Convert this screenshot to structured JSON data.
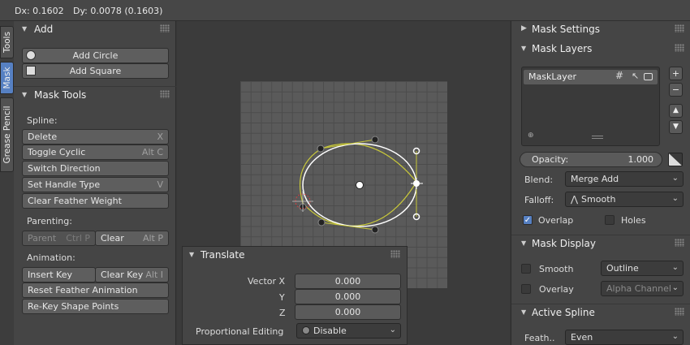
{
  "header": {
    "dx_label": "Dx: 0.1602",
    "dy_label": "Dy: 0.0078 (0.1603)"
  },
  "tabs": [
    {
      "label": "Tools"
    },
    {
      "label": "Mask"
    },
    {
      "label": "Grease Pencil"
    }
  ],
  "add_panel": {
    "title": "Add",
    "add_circle": "Add Circle",
    "add_square": "Add Square"
  },
  "mask_tools": {
    "title": "Mask Tools",
    "spline_label": "Spline:",
    "delete": "Delete",
    "delete_sc": "X",
    "toggle_cyclic": "Toggle Cyclic",
    "toggle_cyclic_sc": "Alt C",
    "switch_direction": "Switch Direction",
    "set_handle_type": "Set Handle Type",
    "set_handle_type_sc": "V",
    "clear_feather": "Clear Feather Weight",
    "parenting_label": "Parenting:",
    "parent": "Parent",
    "parent_sc": "Ctrl P",
    "clear": "Clear",
    "clear_sc": "Alt P",
    "animation_label": "Animation:",
    "insert_key": "Insert Key",
    "clear_key": "Clear Key",
    "clear_key_sc": "Alt I",
    "reset_feather": "Reset Feather Animation",
    "rekey": "Re-Key Shape Points"
  },
  "translate": {
    "title": "Translate",
    "vector_x_label": "Vector X",
    "vector_x": "0.000",
    "y_label": "Y",
    "y": "0.000",
    "z_label": "Z",
    "z": "0.000",
    "prop_label": "Proportional Editing",
    "prop_value": "Disable"
  },
  "right": {
    "mask_settings": "Mask Settings",
    "mask_layers": "Mask Layers",
    "layer_name": "MaskLayer",
    "opacity_label": "Opacity:",
    "opacity": "1.000",
    "blend_label": "Blend:",
    "blend": "Merge Add",
    "falloff_label": "Falloff:",
    "falloff": "Smooth",
    "overlap": "Overlap",
    "holes": "Holes",
    "mask_display": "Mask Display",
    "smooth": "Smooth",
    "smooth_mode": "Outline",
    "overlay": "Overlay",
    "overlay_mode": "Alpha Channel",
    "active_spline": "Active Spline",
    "feather_label": "Feath..",
    "feather": "Even"
  },
  "colors": {
    "accent": "#5680c2",
    "spline": "#ffffff",
    "feather": "#c8c83a"
  }
}
